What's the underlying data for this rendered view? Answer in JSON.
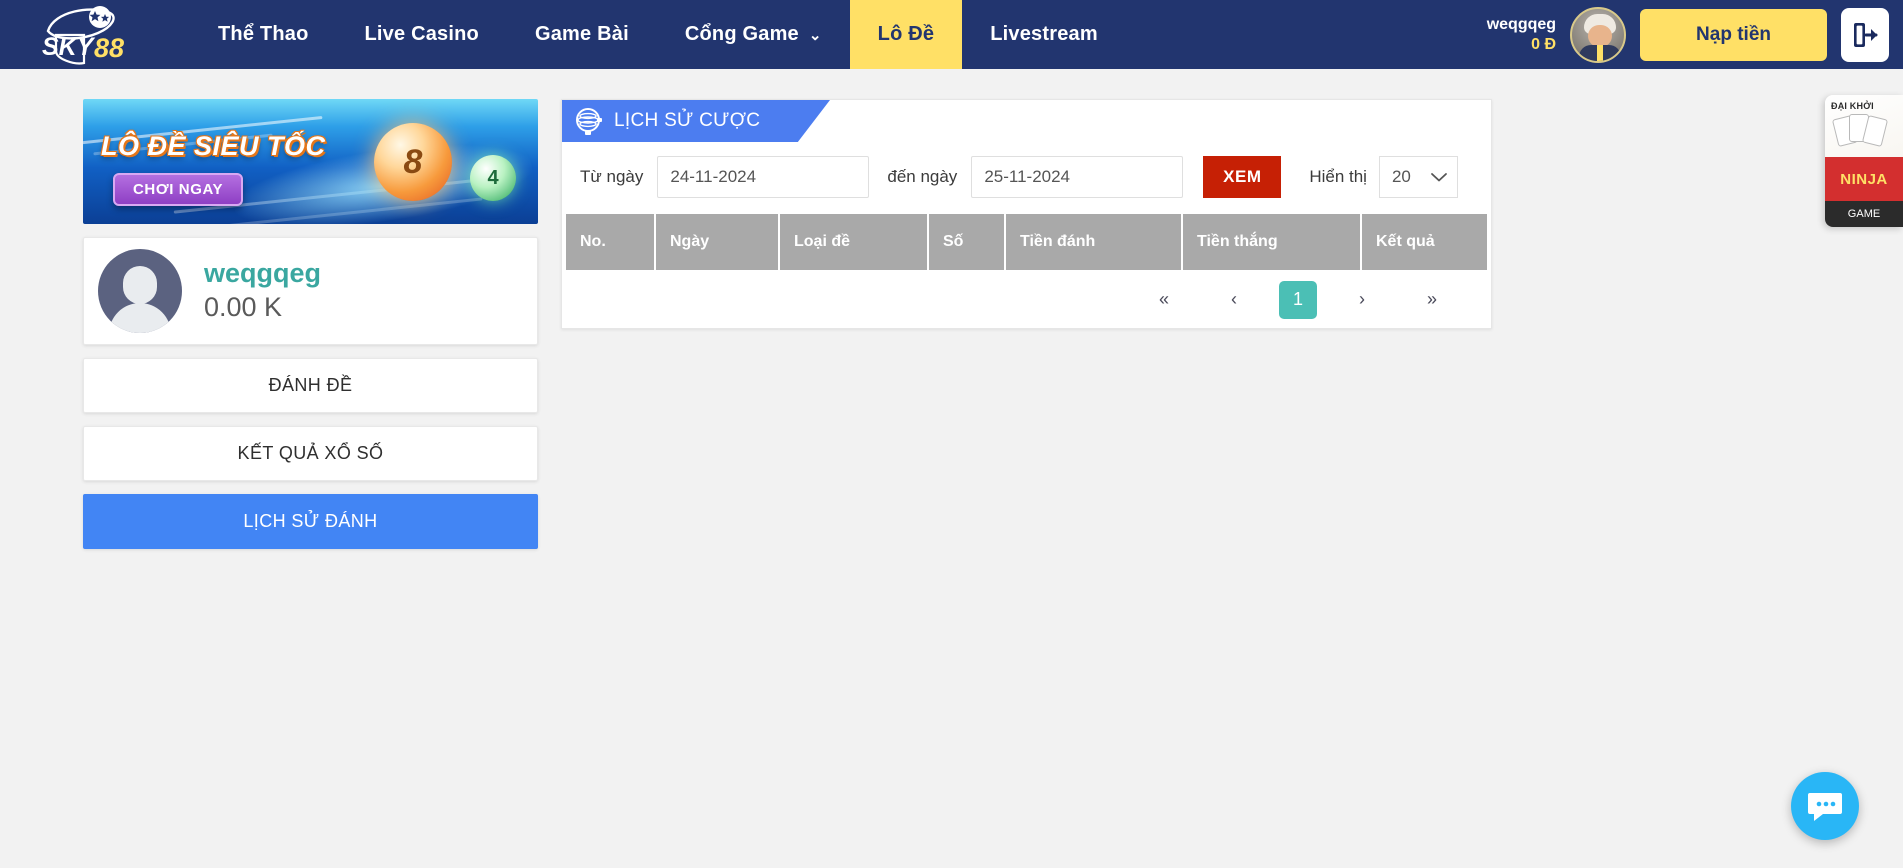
{
  "header": {
    "logo_text": "SKY88",
    "nav": [
      {
        "label": "Thể Thao",
        "active": false,
        "caret": false
      },
      {
        "label": "Live Casino",
        "active": false,
        "caret": false
      },
      {
        "label": "Game Bài",
        "active": false,
        "caret": false
      },
      {
        "label": "Cổng Game",
        "active": false,
        "caret": true
      },
      {
        "label": "Lô Đề",
        "active": true,
        "caret": false
      },
      {
        "label": "Livestream",
        "active": false,
        "caret": false
      }
    ],
    "caret_glyph": "⌄",
    "user_name": "weqgqeg",
    "user_balance": "0 Đ",
    "deposit_label": "Nạp tiền",
    "logout_icon": "logout-icon"
  },
  "sidebar": {
    "banner": {
      "title": "LÔ ĐỀ SIÊU TỐC",
      "cta": "CHƠI NGAY",
      "ball_main": "8",
      "ball_secondary": "4"
    },
    "profile": {
      "name": "weqgqeg",
      "balance": "0.00 K"
    },
    "menu": [
      {
        "label": "ĐÁNH ĐỀ",
        "active": false
      },
      {
        "label": "KẾT QUẢ XỔ SỐ",
        "active": false
      },
      {
        "label": "LỊCH SỬ ĐÁNH",
        "active": true
      }
    ]
  },
  "panel": {
    "title": "LỊCH SỬ CƯỢC",
    "filters": {
      "from_label": "Từ ngày",
      "from_value": "24-11-2024",
      "to_label": "đến ngày",
      "to_value": "25-11-2024",
      "view_button": "XEM",
      "show_label": "Hiển thị",
      "show_value": "20",
      "chevron_glyph": "⌄"
    },
    "table": {
      "columns": [
        "No.",
        "Ngày",
        "Loại đề",
        "Số",
        "Tiền đánh",
        "Tiền thắng",
        "Kết quả"
      ],
      "rows": []
    },
    "pagination": {
      "first": "«",
      "prev": "‹",
      "pages": [
        "1"
      ],
      "current": "1",
      "next": "›",
      "last": "»"
    }
  },
  "side_ad": {
    "top_text": "ĐẠI KHỞI",
    "banner_text": "NINJA",
    "foot_text": "GAME"
  },
  "colors": {
    "header_bg": "#22356f",
    "accent_yellow": "#ffe066",
    "active_blue": "#4285f4",
    "ribbon_blue": "#4c7df0",
    "xem_red": "#c62005",
    "pagination_teal": "#4bbfb5",
    "profile_teal": "#3aa7a0",
    "table_header_gray": "#a9a9a9"
  }
}
